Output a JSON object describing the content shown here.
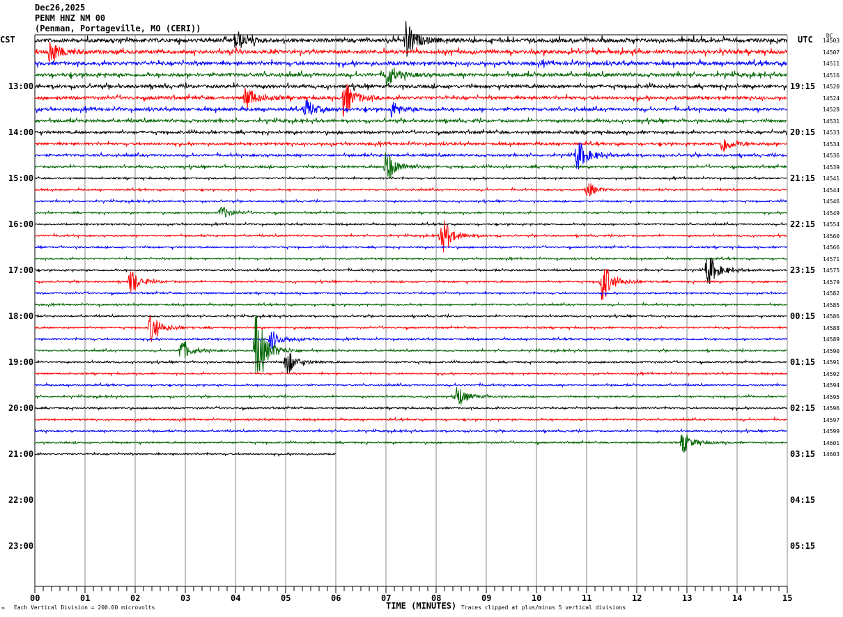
{
  "header": {
    "date": "Dec26,2025",
    "station": "PENM HNZ NM 00",
    "location": "(Penman, Portageville, MO (CERI))"
  },
  "left_timezone": "CST",
  "right_timezone": "UTC",
  "dc_label": "DC",
  "footer": {
    "scale_note": "Each Vertical Division =  200.00 microvolts",
    "xlabel": "TIME (MINUTES)",
    "clip_note": "Traces clipped at plus/minus 5 vertical divisions",
    "corner_mark": "≈"
  },
  "chart_data": {
    "type": "line",
    "subtype": "helicorder",
    "xlabel": "TIME (MINUTES)",
    "xlim": [
      0,
      15
    ],
    "x_ticks": [
      "00",
      "01",
      "02",
      "03",
      "04",
      "05",
      "06",
      "07",
      "08",
      "09",
      "10",
      "11",
      "12",
      "13",
      "14",
      "15"
    ],
    "left_hour_labels": [
      "13:00",
      "14:00",
      "15:00",
      "16:00",
      "17:00",
      "18:00",
      "19:00",
      "20:00",
      "21:00",
      "22:00",
      "23:00"
    ],
    "right_hour_labels": [
      "19:15",
      "20:15",
      "21:15",
      "22:15",
      "23:15",
      "00:15",
      "01:15",
      "02:15",
      "03:15",
      "04:15",
      "05:15"
    ],
    "trace_colors": [
      "#000000",
      "#ff0000",
      "#0000ff",
      "#006400"
    ],
    "dc_offsets": [
      14503,
      14507,
      14511,
      14516,
      14520,
      14524,
      14528,
      14531,
      14533,
      14534,
      14536,
      14539,
      14541,
      14544,
      14546,
      14549,
      14554,
      14560,
      14566,
      14571,
      14575,
      14579,
      14582,
      14585,
      14586,
      14588,
      14589,
      14590,
      14591,
      14592,
      14594,
      14595,
      14596,
      14597,
      14599,
      14601,
      14603
    ],
    "last_trace_end_minute": 6.0,
    "events": [
      {
        "trace": 0,
        "minute": 7.4,
        "amp": 1.6
      },
      {
        "trace": 0,
        "minute": 4.0,
        "amp": 0.9
      },
      {
        "trace": 1,
        "minute": 0.3,
        "amp": 1.1
      },
      {
        "trace": 3,
        "minute": 7.0,
        "amp": 1.0
      },
      {
        "trace": 5,
        "minute": 4.2,
        "amp": 1.1
      },
      {
        "trace": 5,
        "minute": 6.15,
        "amp": 1.6
      },
      {
        "trace": 6,
        "minute": 5.4,
        "amp": 0.8
      },
      {
        "trace": 6,
        "minute": 7.1,
        "amp": 0.7
      },
      {
        "trace": 9,
        "minute": 13.7,
        "amp": 0.8
      },
      {
        "trace": 10,
        "minute": 10.8,
        "amp": 1.4
      },
      {
        "trace": 11,
        "minute": 7.0,
        "amp": 1.5
      },
      {
        "trace": 13,
        "minute": 11.0,
        "amp": 0.7
      },
      {
        "trace": 15,
        "minute": 3.7,
        "amp": 0.6
      },
      {
        "trace": 17,
        "minute": 8.1,
        "amp": 1.7
      },
      {
        "trace": 20,
        "minute": 13.4,
        "amp": 1.5
      },
      {
        "trace": 21,
        "minute": 1.9,
        "amp": 1.1
      },
      {
        "trace": 21,
        "minute": 11.3,
        "amp": 1.9
      },
      {
        "trace": 25,
        "minute": 2.3,
        "amp": 1.3
      },
      {
        "trace": 26,
        "minute": 4.7,
        "amp": 0.9
      },
      {
        "trace": 27,
        "minute": 2.9,
        "amp": 1.0
      },
      {
        "trace": 27,
        "minute": 4.4,
        "amp": 3.5
      },
      {
        "trace": 28,
        "minute": 5.0,
        "amp": 1.2
      },
      {
        "trace": 31,
        "minute": 8.4,
        "amp": 1.0
      },
      {
        "trace": 35,
        "minute": 12.9,
        "amp": 1.0
      }
    ]
  }
}
